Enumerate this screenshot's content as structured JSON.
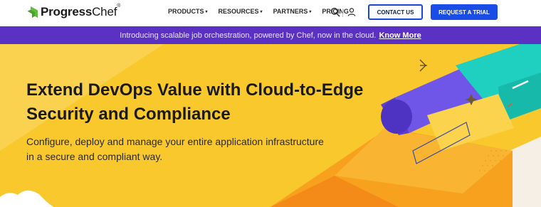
{
  "brand": {
    "name_bold": "Progress",
    "name_light": "Chef",
    "trademark": "®",
    "logo_color": "#5ebc3a"
  },
  "nav": {
    "items": [
      {
        "label": "PRODUCTS",
        "has_dropdown": true
      },
      {
        "label": "RESOURCES",
        "has_dropdown": true
      },
      {
        "label": "PARTNERS",
        "has_dropdown": true
      },
      {
        "label": "PRICING",
        "has_dropdown": false
      }
    ],
    "dropdown_glyph": "▾",
    "icons": [
      "search-icon",
      "user-icon"
    ],
    "contact_label": "CONTACT US",
    "trial_label": "REQUEST A TRIAL"
  },
  "announcement": {
    "text": "Introducing scalable job orchestration, powered by Chef, now in the cloud.",
    "link_label": "Know More",
    "background": "#5b31c4"
  },
  "hero": {
    "title_lines": [
      "Extend DevOps Value with Cloud-to-Edge",
      "Security and Compliance"
    ],
    "subtitle_lines": [
      "Configure, deploy and manage your entire application infrastructure",
      "in a secure and compliant way."
    ],
    "background": "#f9c82c"
  },
  "colors": {
    "primary_blue": "#1a4de6",
    "purple": "#5b31c4",
    "teal": "#1fd0c0",
    "orange": "#f7921e",
    "yellow": "#f9c82c"
  }
}
